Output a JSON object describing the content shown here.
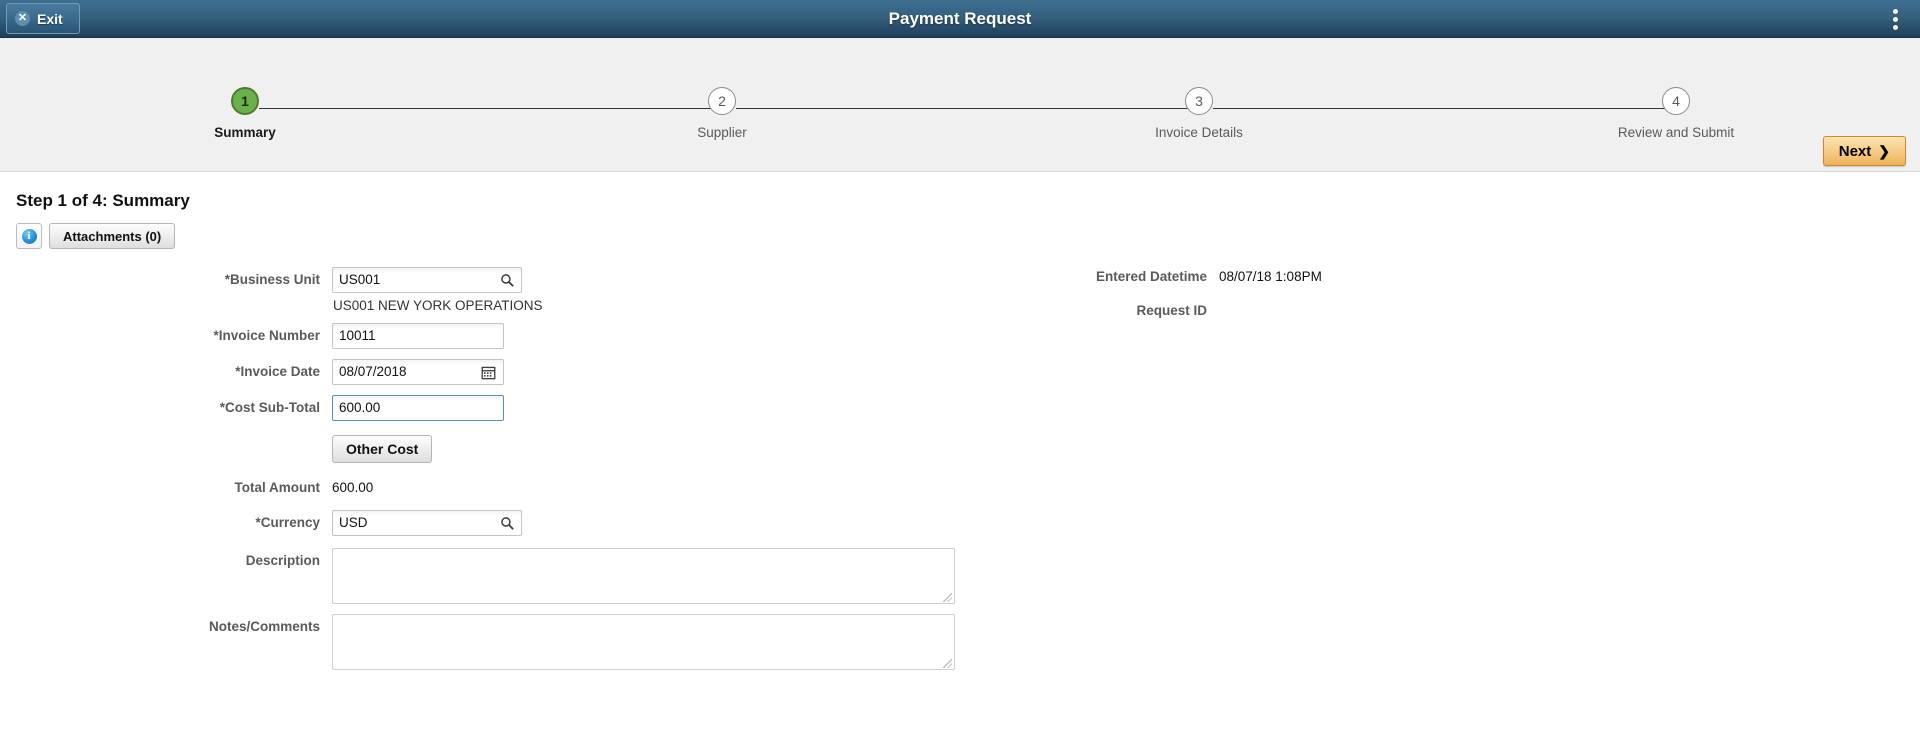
{
  "appbar": {
    "exit_label": "Exit",
    "exit_icon": "close-x-icon",
    "title": "Payment Request",
    "menu_icon": "vertical-ellipsis-icon"
  },
  "steps": {
    "items": [
      {
        "number": "1",
        "label": "Summary",
        "state": "active"
      },
      {
        "number": "2",
        "label": "Supplier",
        "state": "inactive"
      },
      {
        "number": "3",
        "label": "Invoice Details",
        "state": "inactive"
      },
      {
        "number": "4",
        "label": "Review and Submit",
        "state": "inactive"
      }
    ],
    "next_label": "Next",
    "next_chevron": "❯",
    "active_color": "#6ab04c",
    "next_accent": "#efb15a"
  },
  "page": {
    "title": "Step 1 of 4: Summary",
    "info_icon": "info-icon",
    "info_glyph": "i",
    "attachments_label": "Attachments (0)"
  },
  "form": {
    "business_unit": {
      "label": "*Business Unit",
      "value": "US001",
      "placeholder": "",
      "lookup_icon": "search-icon",
      "helper": "US001 NEW YORK OPERATIONS"
    },
    "invoice_number": {
      "label": "*Invoice Number",
      "value": "10011",
      "placeholder": ""
    },
    "invoice_date": {
      "label": "*Invoice Date",
      "value": "08/07/2018",
      "placeholder": "",
      "calendar_icon": "calendar-icon"
    },
    "cost_subtotal": {
      "label": "*Cost Sub-Total",
      "value": "600.00",
      "placeholder": "",
      "focused": true
    },
    "other_cost_label": "Other Cost",
    "total_amount": {
      "label": "Total Amount",
      "value": "600.00"
    },
    "currency": {
      "label": "*Currency",
      "value": "USD",
      "placeholder": "",
      "lookup_icon": "search-icon"
    },
    "description": {
      "label": "Description",
      "value": "",
      "placeholder": ""
    },
    "notes_comments": {
      "label": "Notes/Comments",
      "value": "",
      "placeholder": ""
    }
  },
  "info_panel": {
    "entered_datetime_label": "Entered Datetime",
    "entered_datetime_value": "08/07/18  1:08PM",
    "request_id_label": "Request ID",
    "request_id_value": ""
  }
}
